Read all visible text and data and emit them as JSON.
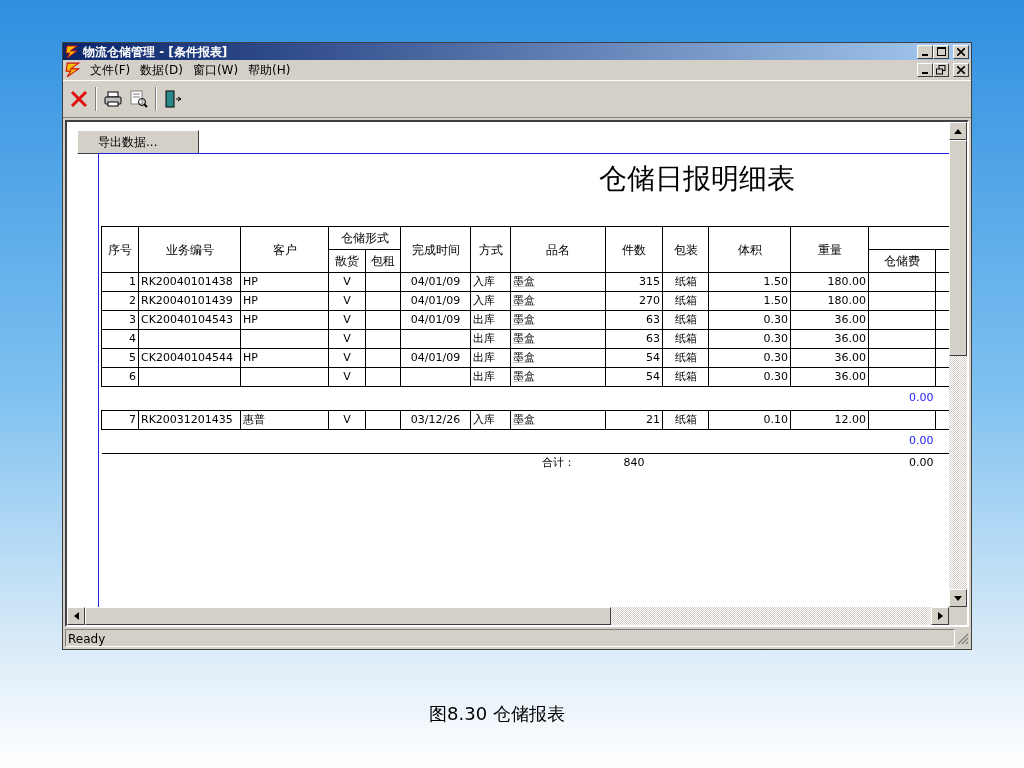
{
  "window": {
    "title": "物流仓储管理 - [条件报表]"
  },
  "menu": [
    {
      "label": "文件(F)"
    },
    {
      "label": "数据(D)"
    },
    {
      "label": "窗口(W)"
    },
    {
      "label": "帮助(H)"
    }
  ],
  "report": {
    "export_button": "导出数据...",
    "title": "仓储日报明细表",
    "columns": [
      {
        "label": "序号"
      },
      {
        "label": "业务编号"
      },
      {
        "label": "客户"
      },
      {
        "label": "仓储形式",
        "sub": [
          "散货",
          "包租"
        ]
      },
      {
        "label": "完成时间"
      },
      {
        "label": "方式"
      },
      {
        "label": "品名"
      },
      {
        "label": "件数"
      },
      {
        "label": "包装"
      },
      {
        "label": "体积"
      },
      {
        "label": "重量"
      },
      {
        "sub": [
          "仓储费"
        ]
      }
    ],
    "groups": [
      {
        "rows": [
          {
            "no": "1",
            "code": "RK20040101438",
            "client": "HP",
            "bulk": "V",
            "date": "04/01/09",
            "mode": "入库",
            "item": "墨盒",
            "qty": "315",
            "pack": "纸箱",
            "volume": "1.50",
            "weight": "180.00"
          },
          {
            "no": "2",
            "code": "RK20040101439",
            "client": "HP",
            "bulk": "V",
            "date": "04/01/09",
            "mode": "入库",
            "item": "墨盒",
            "qty": "270",
            "pack": "纸箱",
            "volume": "1.50",
            "weight": "180.00"
          },
          {
            "no": "3",
            "code": "CK20040104543",
            "client": "HP",
            "bulk": "V",
            "date": "04/01/09",
            "mode": "出库",
            "item": "墨盒",
            "qty": "63",
            "pack": "纸箱",
            "volume": "0.30",
            "weight": "36.00"
          },
          {
            "no": "4",
            "bulk": "V",
            "mode": "出库",
            "item": "墨盒",
            "qty": "63",
            "pack": "纸箱",
            "volume": "0.30",
            "weight": "36.00"
          },
          {
            "no": "5",
            "code": "CK20040104544",
            "client": "HP",
            "bulk": "V",
            "date": "04/01/09",
            "mode": "出库",
            "item": "墨盒",
            "qty": "54",
            "pack": "纸箱",
            "volume": "0.30",
            "weight": "36.00"
          },
          {
            "no": "6",
            "bulk": "V",
            "mode": "出库",
            "item": "墨盒",
            "qty": "54",
            "pack": "纸箱",
            "volume": "0.30",
            "weight": "36.00"
          }
        ],
        "subtotal": "0.00"
      },
      {
        "rows": [
          {
            "no": "7",
            "code": "RK20031201435",
            "client": "惠普",
            "bulk": "V",
            "date": "03/12/26",
            "mode": "入库",
            "item": "墨盒",
            "qty": "21",
            "pack": "纸箱",
            "volume": "0.10",
            "weight": "12.00"
          }
        ],
        "subtotal": "0.00"
      }
    ],
    "total": {
      "label": "合计：",
      "qty": "840",
      "fee": "0.00"
    }
  },
  "status_bar": "Ready",
  "caption": "图8.30 仓储报表"
}
